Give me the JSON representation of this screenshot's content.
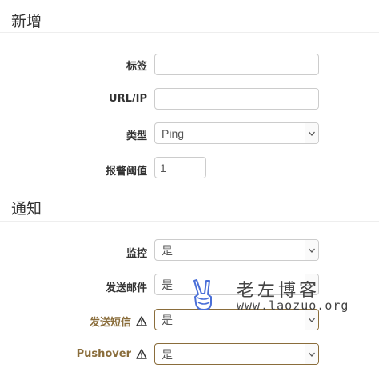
{
  "sections": {
    "add_title": "新增",
    "notify_title": "通知"
  },
  "form": {
    "tag_label": "标签",
    "tag_value": "",
    "url_label": "URL/IP",
    "url_value": "",
    "type_label": "类型",
    "type_value": "Ping",
    "threshold_label": "报警阈值",
    "threshold_value": "1"
  },
  "notify": {
    "monitor_label": "监控",
    "monitor_value": "是",
    "email_label": "发送邮件",
    "email_value": "是",
    "sms_label": "发送短信",
    "sms_value": "是",
    "pushover_label": "Pushover",
    "pushover_value": "是"
  },
  "watermark": {
    "title": "老左博客",
    "url": "www.laozuo.org"
  },
  "colors": {
    "warning": "#8a6d3b",
    "border": "#cccccc",
    "logo": "#4a6fd8"
  },
  "icons": [
    "warning-icon",
    "chevron-down-icon",
    "hand-logo-icon"
  ]
}
